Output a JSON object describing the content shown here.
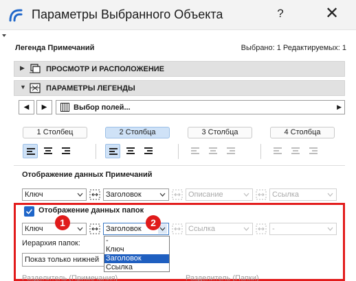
{
  "window": {
    "title": "Параметры Выбранного Объекта",
    "help_label": "?",
    "close_label": "✕"
  },
  "header": {
    "object_name": "Легенда Примечаний",
    "selection_info": "Выбрано: 1 Редактируемых: 1"
  },
  "sections": {
    "view_placement": "ПРОСМОТР И РАСПОЛОЖЕНИЕ",
    "legend_params": "ПАРАМЕТРЫ ЛЕГЕНДЫ"
  },
  "nav": {
    "prev_label": "◀",
    "next_label": "▶",
    "field_select_label": "Выбор полей...",
    "more_label": "▶"
  },
  "columns": {
    "options": [
      "1 Столбец",
      "2 Столбца",
      "3 Столбца",
      "4 Столбца"
    ],
    "selected": "2 Столбца"
  },
  "note_data": {
    "title": "Отображение данных Примечаний",
    "key_value": "Ключ",
    "heading_value": "Заголовок",
    "description_value": "Описание",
    "link_value": "Ссылка"
  },
  "folder_data": {
    "checkbox_label": "Отображение данных папок",
    "checked": true,
    "key_value": "Ключ",
    "heading_value": "Заголовок",
    "link_value": "Ссылка",
    "empty_value": "-",
    "hierarchy_label": "Иерархия папок:",
    "hierarchy_value": "Показ только нижней"
  },
  "dropdown_list": {
    "items": [
      "-",
      "Ключ",
      "Заголовок",
      "Ссылка"
    ],
    "selected": "Заголовок"
  },
  "badges": {
    "first": "1",
    "second": "2"
  },
  "bottom": {
    "separator_notes": "Разделитель (Примечания)",
    "separator_folders": "Разделитель (Папки)"
  },
  "colors": {
    "accent": "#1f66c9",
    "highlight_box": "#e21b1b",
    "selected_tab": "#cfe2f7"
  }
}
